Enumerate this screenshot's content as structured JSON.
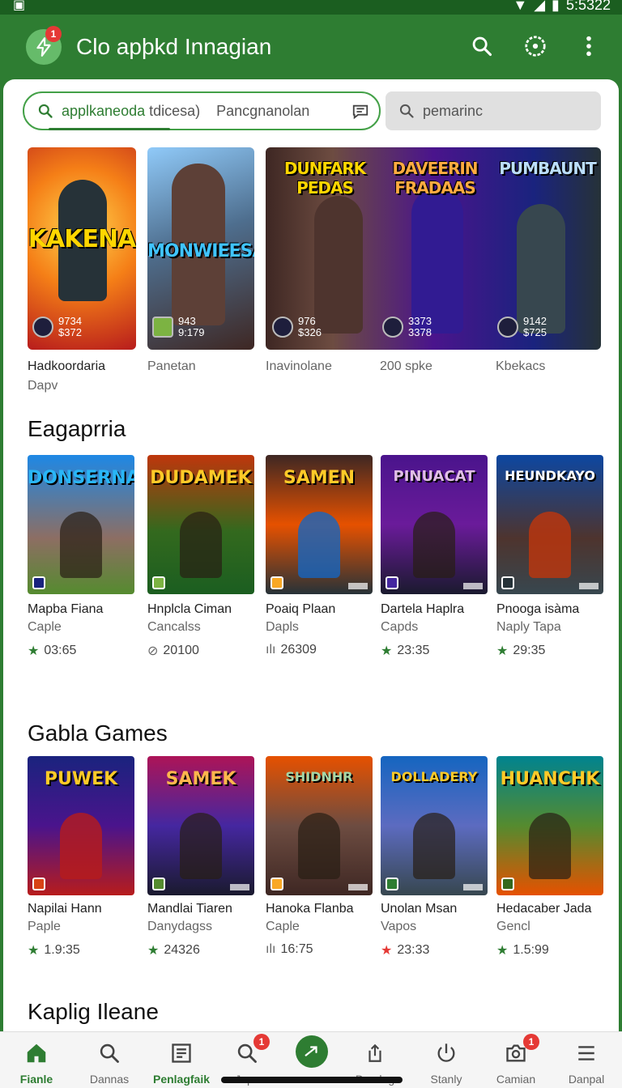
{
  "status_bar": {
    "time": "5:5322"
  },
  "app": {
    "title": "Clo apþkd Innagian",
    "notification_count": "1"
  },
  "search": {
    "query": "applkaneoda",
    "query_typed": "tdicesa)",
    "query_suffix": "Pancgnanolan",
    "secondary_placeholder": "pemarinc"
  },
  "featured": [
    {
      "art_title": "KAKENA",
      "stat_line1": "9734",
      "stat_line2": "$372",
      "label": "Hadkoordaria",
      "sublabel": "Dapv"
    },
    {
      "art_title": "MONWIEESA",
      "stat_line1": "943",
      "stat_line2": "9:179",
      "label": "Panetan"
    },
    {
      "art_title": "DUNFARK PEDAS",
      "stat_line1": "976",
      "stat_line2": "$326",
      "label": "Inavinolane"
    },
    {
      "art_title": "DAVEERIN FRADAAS",
      "stat_line1": "3373",
      "stat_line2": "3378",
      "label": "200 spke"
    },
    {
      "art_title": "PUMBAUNT",
      "stat_line1": "9142",
      "stat_line2": "$725",
      "label": "Kbekacs"
    }
  ],
  "section1": {
    "title": "Eagaprria",
    "games": [
      {
        "art_title": "DONSERNA",
        "name": "Mapba Fiana",
        "developer": "Caple",
        "rating": "03:65",
        "star_color": "#2e7d32"
      },
      {
        "art_title": "DUDAMEK",
        "name": "Hnplcla Ciman",
        "developer": "Cancalss",
        "rating": "20100",
        "star_color": "#666666"
      },
      {
        "art_title": "SAMEN",
        "name": "Poaiq Plaan",
        "developer": "Dapls",
        "rating": "26309",
        "star_color": "#666666"
      },
      {
        "art_title": "PINUACAT",
        "name": "Dartela Haplra",
        "developer": "Capds",
        "rating": "23:35",
        "star_color": "#2e7d32"
      },
      {
        "art_title": "HEUNDKAYO",
        "name": "Pnooga isàma",
        "developer": "Naply Tapa",
        "rating": "29:35",
        "star_color": "#2e7d32"
      }
    ]
  },
  "section2": {
    "title": "Gabla Games",
    "games": [
      {
        "art_title": "PUWEK",
        "name": "Napilai Hann",
        "developer": "Paple",
        "rating": "1.9:35",
        "star_color": "#2e7d32"
      },
      {
        "art_title": "SAMEK",
        "name": "Mandlai Tiaren",
        "developer": "Danydagss",
        "rating": "24326",
        "star_color": "#2e7d32"
      },
      {
        "art_title": "SHIDNHR",
        "name": "Hanoka Flanba",
        "developer": "Caple",
        "rating": "16:75",
        "star_color": "#666666"
      },
      {
        "art_title": "DOLLADERY",
        "name": "Unolan Msan",
        "developer": "Vapos",
        "rating": "23:33",
        "star_color": "#e53935"
      },
      {
        "art_title": "HUANCHK",
        "name": "Hedacaber Jada",
        "developer": "Gencl",
        "rating": "1.5:99",
        "star_color": "#2e7d32"
      }
    ]
  },
  "section3": {
    "title": "Kaplig Ileane"
  },
  "nav": {
    "items": [
      {
        "label": "Fianle",
        "icon": "home-icon"
      },
      {
        "label": "Dannas",
        "icon": "search-icon"
      },
      {
        "label": "Penlagfaik",
        "icon": "news-icon"
      },
      {
        "label": "Jeps",
        "icon": "search-icon",
        "badge": "1"
      },
      {
        "label": "",
        "icon": "send-icon"
      },
      {
        "label": "Damlag",
        "icon": "share-icon"
      },
      {
        "label": "Stanly",
        "icon": "power-icon"
      },
      {
        "label": "Camian",
        "icon": "camera-icon",
        "badge": "1"
      },
      {
        "label": "Danpal",
        "icon": "menu-icon"
      }
    ]
  },
  "colors": {
    "primary": "#2e7d32",
    "accent": "#43a047",
    "badge": "#e53935"
  }
}
